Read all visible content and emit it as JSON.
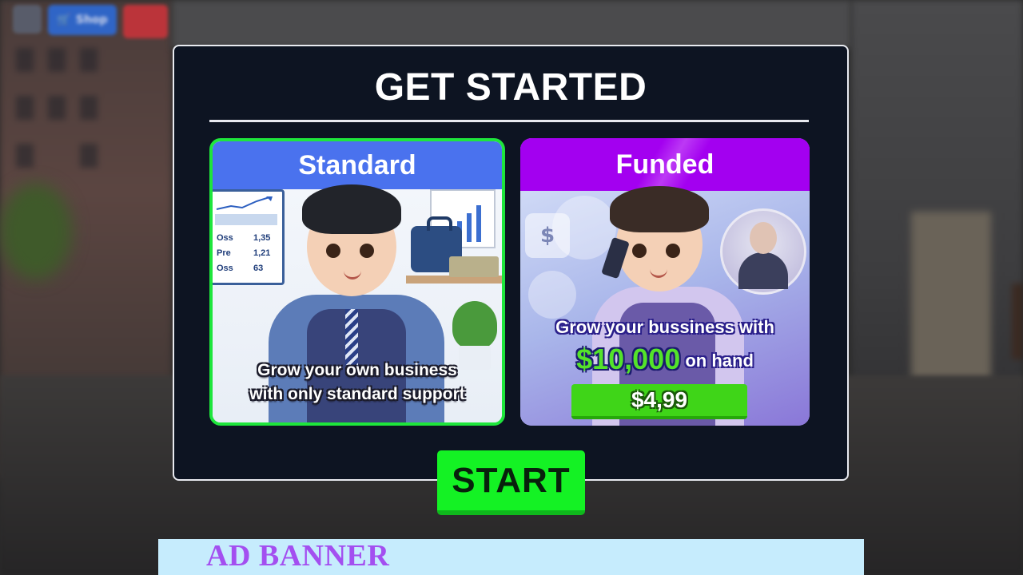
{
  "hud": {
    "shop_label": "Shop"
  },
  "modal": {
    "title": "GET STARTED"
  },
  "cards": {
    "standard": {
      "title": "Standard",
      "description_line1": "Grow your own business",
      "description_line2": "with only standard support",
      "board_rows": [
        {
          "label": "Oss",
          "value": "1,35"
        },
        {
          "label": "Pre",
          "value": "1,21"
        },
        {
          "label": "Oss",
          "value": "63"
        }
      ],
      "selected": true
    },
    "funded": {
      "title": "Funded",
      "description_line1": "Grow your bussiness with",
      "amount": "$10,000",
      "amount_suffix": "on hand",
      "price": "$4,99",
      "dollar_symbol": "$"
    }
  },
  "start_button": {
    "label": "START"
  },
  "ad_banner": {
    "label": "AD BANNER"
  },
  "colors": {
    "modal_bg": "#0d1422",
    "standard_header": "#4a72ee",
    "funded_header": "#a300f0",
    "selected_border": "#1ee63c",
    "start_button": "#14f224",
    "price_button": "#3fd518",
    "ad_bg": "#c6ecfd",
    "ad_text": "#a34ff0"
  }
}
